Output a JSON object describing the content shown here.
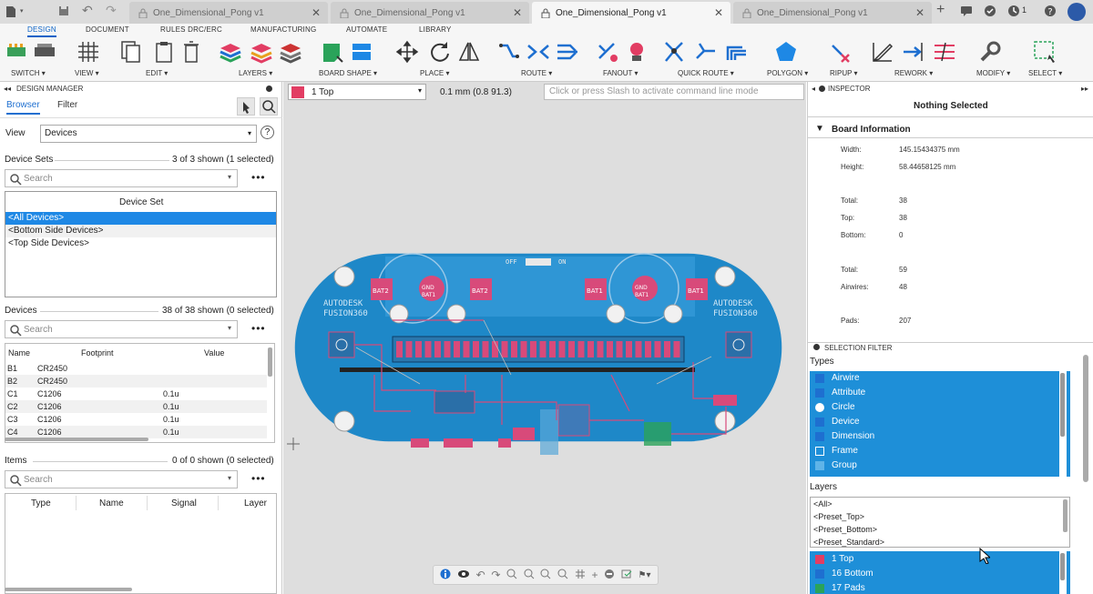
{
  "tabs": [
    {
      "label": "One_Dimensional_Pong v1",
      "active": false
    },
    {
      "label": "One_Dimensional_Pong v1",
      "active": false
    },
    {
      "label": "One_Dimensional_Pong v1",
      "active": true
    },
    {
      "label": "One_Dimensional_Pong v1",
      "active": false
    }
  ],
  "topbar": {
    "notification_count": "1"
  },
  "ribbon": {
    "tabs": [
      "DESIGN",
      "DOCUMENT",
      "RULES DRC/ERC",
      "MANUFACTURING",
      "AUTOMATE",
      "LIBRARY"
    ],
    "groups": [
      "SWITCH ▾",
      "VIEW ▾",
      "EDIT ▾",
      "LAYERS ▾",
      "BOARD SHAPE ▾",
      "PLACE ▾",
      "ROUTE ▾",
      "FANOUT ▾",
      "QUICK ROUTE ▾",
      "POLYGON ▾",
      "RIPUP ▾",
      "REWORK ▾",
      "MODIFY ▾",
      "SELECT ▾"
    ]
  },
  "design_manager": {
    "title": "DESIGN MANAGER",
    "tabs": [
      "Browser",
      "Filter"
    ],
    "view_label": "View",
    "view_value": "Devices",
    "device_sets": {
      "label": "Device Sets",
      "count": "3 of 3 shown (1 selected)",
      "search_placeholder": "Search",
      "column": "Device Set",
      "items": [
        "<All Devices>",
        "<Bottom Side Devices>",
        "<Top Side Devices>"
      ]
    },
    "devices": {
      "label": "Devices",
      "count": "38 of 38 shown (0 selected)",
      "search_placeholder": "Search",
      "columns": [
        "Name",
        "Footprint",
        "Value"
      ],
      "rows": [
        {
          "name": "B1",
          "footprint": "CR2450",
          "value": ""
        },
        {
          "name": "B2",
          "footprint": "CR2450",
          "value": ""
        },
        {
          "name": "C1",
          "footprint": "C1206",
          "value": "0.1u"
        },
        {
          "name": "C2",
          "footprint": "C1206",
          "value": "0.1u"
        },
        {
          "name": "C3",
          "footprint": "C1206",
          "value": "0.1u"
        },
        {
          "name": "C4",
          "footprint": "C1206",
          "value": "0.1u"
        }
      ]
    },
    "items": {
      "label": "Items",
      "count": "0 of 0 shown (0 selected)",
      "search_placeholder": "Search",
      "columns": [
        "Type",
        "Name",
        "Signal",
        "Layer"
      ]
    }
  },
  "canvas": {
    "layer": "1 Top",
    "grid": "0.1 mm (0.8 91.3)",
    "command_placeholder": "Click or press Slash to activate command line mode",
    "layer_color": "#e23d63",
    "board": {
      "brand": "AUTODESK",
      "product": "FUSION360",
      "switch_off": "OFF",
      "switch_on": "ON",
      "bat_labels": [
        "BAT2",
        "GND\nBAT1",
        "BAT2",
        "BAT1",
        "GND\nBAT1",
        "BAT1"
      ]
    }
  },
  "inspector": {
    "title": "INSPECTOR",
    "status": "Nothing Selected",
    "section": "Board Information",
    "rows": [
      {
        "k": "Width:",
        "v": "145.15434375 mm"
      },
      {
        "k": "Height:",
        "v": "58.44658125 mm"
      },
      {
        "k": "Total:",
        "v": "38"
      },
      {
        "k": "Top:",
        "v": "38"
      },
      {
        "k": "Bottom:",
        "v": "0"
      },
      {
        "k": "Total:",
        "v": "59"
      },
      {
        "k": "Airwires:",
        "v": "48"
      },
      {
        "k": "Pads:",
        "v": "207"
      }
    ]
  },
  "selection_filter": {
    "title": "SELECTION FILTER",
    "types_label": "Types",
    "types": [
      "Airwire",
      "Attribute",
      "Circle",
      "Device",
      "Dimension",
      "Frame",
      "Group"
    ],
    "layers_label": "Layers",
    "presets": [
      "<All>",
      "<Preset_Top>",
      "<Preset_Bottom>",
      "<Preset_Standard>"
    ],
    "layers": [
      {
        "name": "1 Top",
        "color": "#e23d63"
      },
      {
        "name": "16 Bottom",
        "color": "#1e6fd0"
      },
      {
        "name": "17 Pads",
        "color": "#2aa35a"
      }
    ]
  }
}
